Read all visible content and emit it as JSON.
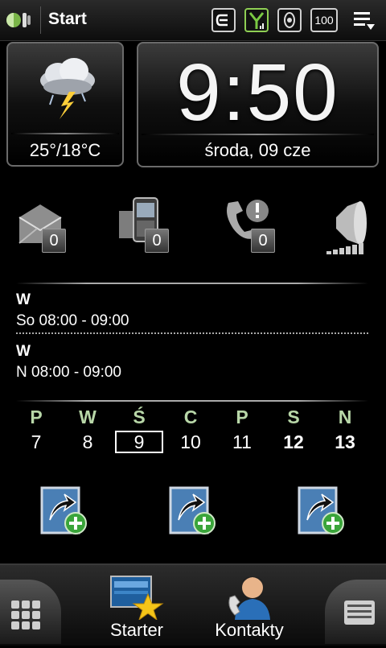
{
  "header": {
    "title": "Start",
    "battery_label": "100"
  },
  "weather": {
    "temperature": "25°/18°C",
    "icon": "thunderstorm-cloud-icon"
  },
  "clock": {
    "time": "9:50",
    "date": "środa, 09 cze"
  },
  "notifications": [
    {
      "icon": "mail-icon",
      "count": "0"
    },
    {
      "icon": "sms-phone-icon",
      "count": "0"
    },
    {
      "icon": "missed-call-icon",
      "count": "0"
    },
    {
      "icon": "volume-speaker-icon"
    }
  ],
  "appointments": [
    {
      "title": "W",
      "time": "So 08:00 - 09:00"
    },
    {
      "title": "W",
      "time": "N 08:00 - 09:00"
    }
  ],
  "week": {
    "days": [
      {
        "name": "P",
        "num": "7"
      },
      {
        "name": "W",
        "num": "8"
      },
      {
        "name": "Ś",
        "num": "9",
        "selected": true
      },
      {
        "name": "C",
        "num": "10"
      },
      {
        "name": "P",
        "num": "11"
      },
      {
        "name": "S",
        "num": "12",
        "bold": true
      },
      {
        "name": "N",
        "num": "13",
        "bold": true
      }
    ]
  },
  "bottom": {
    "tab1_label": "Starter",
    "tab2_label": "Kontakty"
  },
  "colors": {
    "accent_green": "#b8d7a8",
    "badge_bg": "#555555"
  }
}
